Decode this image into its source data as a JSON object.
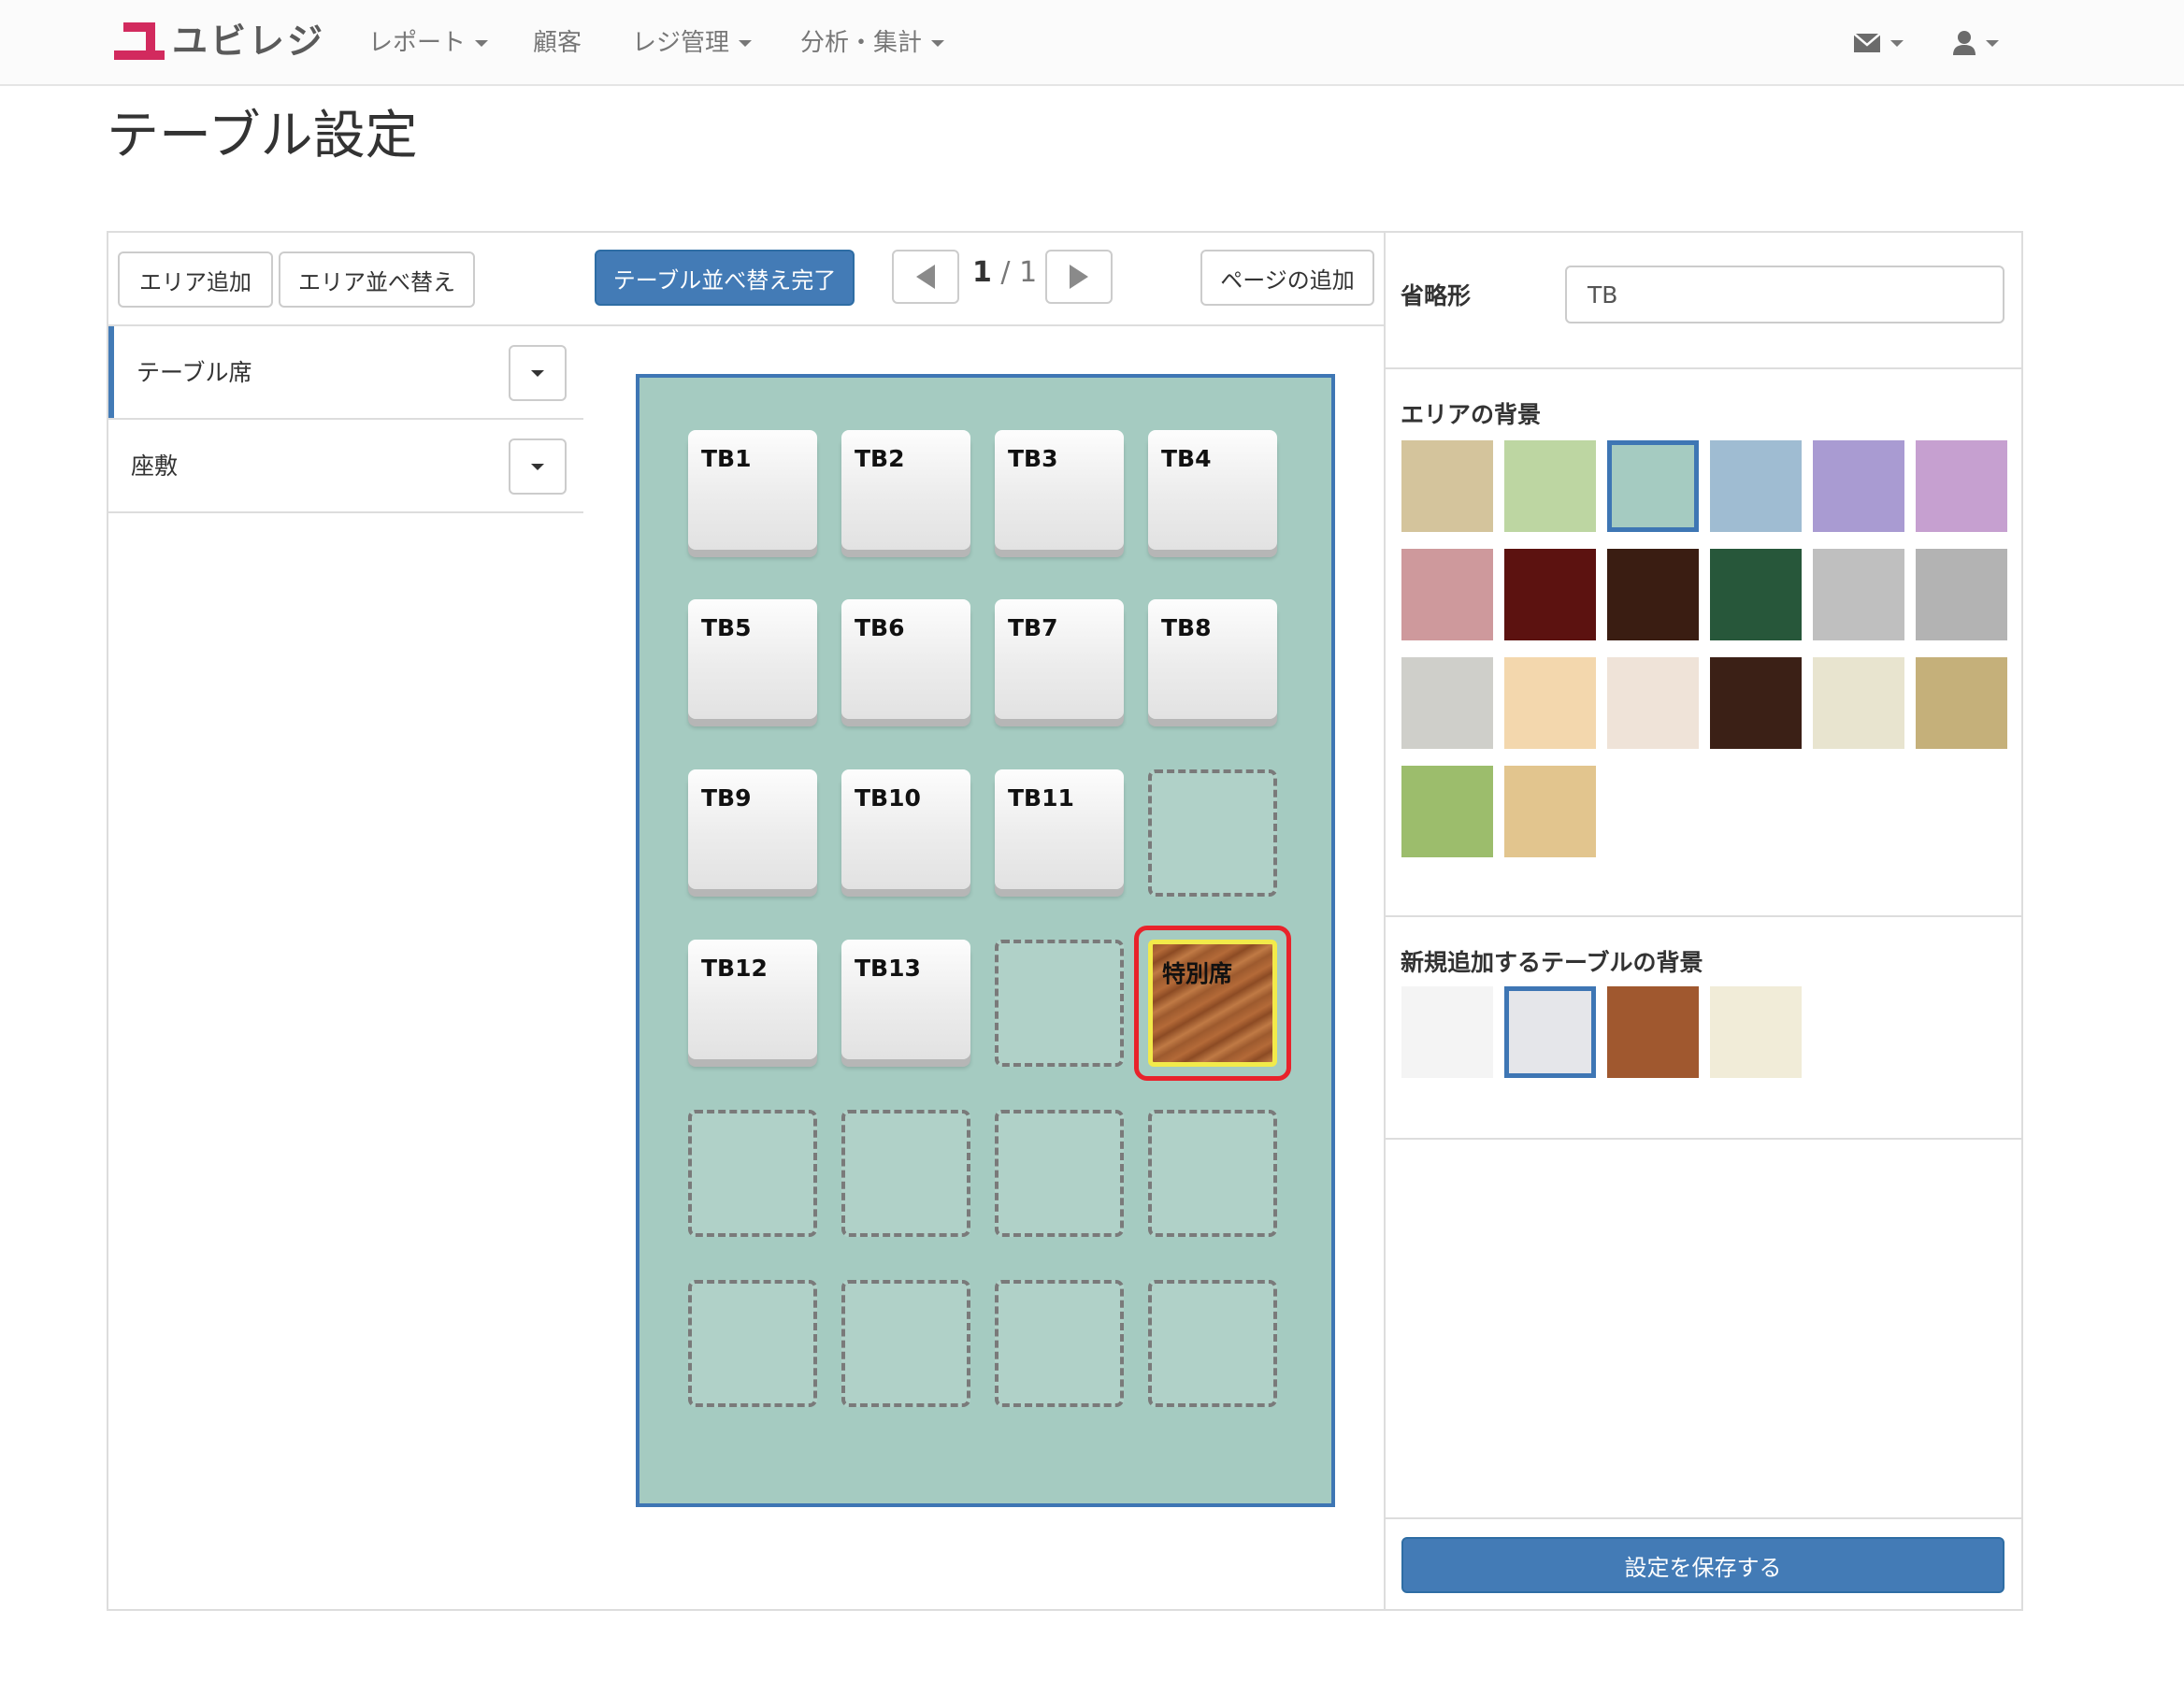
{
  "navbar": {
    "brand": "ユビレジ",
    "menu": [
      {
        "label": "レポート",
        "dropdown": true
      },
      {
        "label": "顧客",
        "dropdown": false
      },
      {
        "label": "レジ管理",
        "dropdown": true
      },
      {
        "label": "分析・集計",
        "dropdown": true
      }
    ],
    "icons": [
      "envelope-icon",
      "user-icon"
    ]
  },
  "page": {
    "title": "テーブル設定"
  },
  "left_panel": {
    "add_area_label": "エリア追加",
    "sort_area_label": "エリア並べ替え",
    "areas": [
      {
        "label": "テーブル席",
        "active": true
      },
      {
        "label": "座敷",
        "active": false
      }
    ]
  },
  "center_panel": {
    "sort_done_label": "テーブル並べ替え完了",
    "page_current": "1",
    "page_sep": " / ",
    "page_total": "1",
    "add_page_label": "ページの追加",
    "floor_background": "#a5cbc1",
    "tables": [
      {
        "label": "TB1"
      },
      {
        "label": "TB2"
      },
      {
        "label": "TB3"
      },
      {
        "label": "TB4"
      },
      {
        "label": "TB5"
      },
      {
        "label": "TB6"
      },
      {
        "label": "TB7"
      },
      {
        "label": "TB8"
      },
      {
        "label": "TB9"
      },
      {
        "label": "TB10"
      },
      {
        "label": "TB11"
      },
      {
        "label": "TB12"
      },
      {
        "label": "TB13"
      },
      {
        "label": "特別席",
        "selected": true
      }
    ]
  },
  "right_panel": {
    "abbr_label": "省略形",
    "abbr_value": "TB",
    "area_bg_label": "エリアの背景",
    "area_bg_swatches": [
      "#d4c49c",
      "#bdd6a2",
      "#a5cbc1",
      "#9fbcd2",
      "#a99bd2",
      "#c6a0d0",
      "#ce999c",
      "#5c1210",
      "#3a1d12",
      "#27573a",
      "#bfbfbf",
      "#b3b3b3",
      "#cfcfca",
      "#f3d7ad",
      "#efe3d8",
      "#3b2016",
      "#e8e4cf",
      "#c5b07a",
      "#9cbd6c",
      "#e2c58e"
    ],
    "area_bg_selected_index": 2,
    "table_bg_label": "新規追加するテーブルの背景",
    "table_bg_swatches": [
      "#f4f4f4",
      "#e5e6ea",
      "#a0582f",
      "#f1ecd8"
    ],
    "table_bg_selected_index": 1,
    "save_label": "設定を保存する"
  },
  "colors": {
    "accent": "#437bb6",
    "brand": "#d22a5e",
    "selection_outline": "#e8232b",
    "selection_inner": "#f2ea4a"
  }
}
